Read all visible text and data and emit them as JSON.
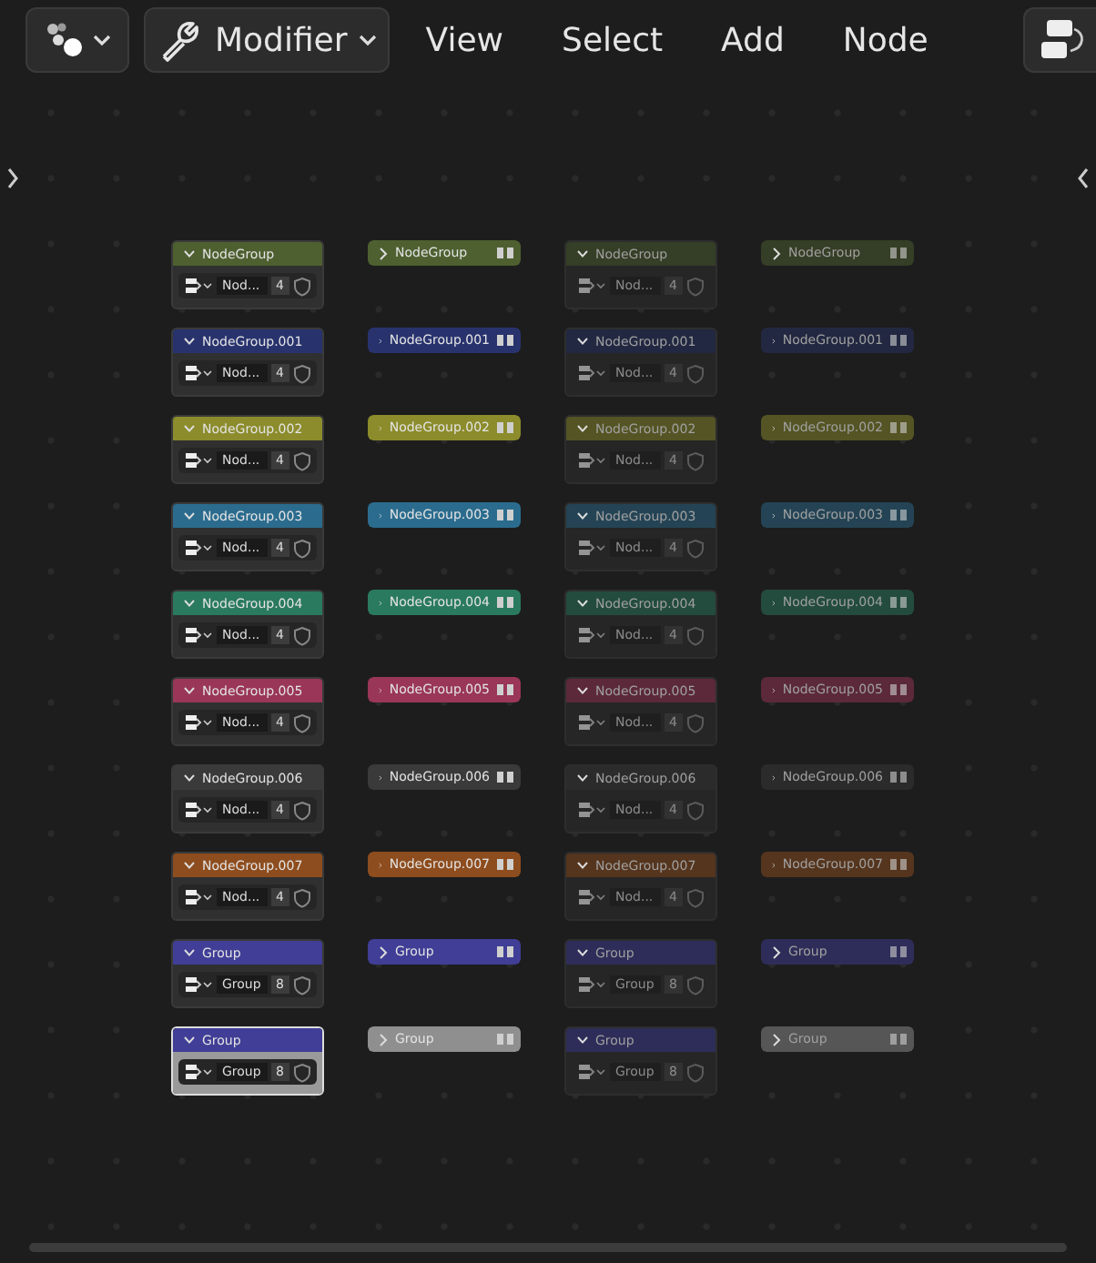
{
  "header": {
    "mode": "Modifier",
    "menus": [
      "View",
      "Select",
      "Add",
      "Node"
    ]
  },
  "nodes": [
    {
      "title": "NodeGroup",
      "color": "#4e6030",
      "collapsed": false,
      "muted": false,
      "active": false,
      "field": "Nod...",
      "count": "4"
    },
    {
      "title": "NodeGroup",
      "color": "#4e6030",
      "collapsed": true,
      "muted": false
    },
    {
      "title": "NodeGroup",
      "color": "#353e26",
      "collapsed": false,
      "muted": true,
      "active": false,
      "field": "Nod...",
      "count": "4"
    },
    {
      "title": "NodeGroup",
      "color": "#353e26",
      "collapsed": true,
      "muted": true
    },
    {
      "title": "NodeGroup.001",
      "color": "#28336e",
      "collapsed": false,
      "muted": false,
      "active": false,
      "field": "Nod...",
      "count": "4"
    },
    {
      "title": "NodeGroup.001",
      "color": "#28336e",
      "collapsed": true,
      "muted": false
    },
    {
      "title": "NodeGroup.001",
      "color": "#222841",
      "collapsed": false,
      "muted": true,
      "active": false,
      "field": "Nod...",
      "count": "4"
    },
    {
      "title": "NodeGroup.001",
      "color": "#222841",
      "collapsed": true,
      "muted": true
    },
    {
      "title": "NodeGroup.002",
      "color": "#8c8c2c",
      "collapsed": false,
      "muted": false,
      "active": false,
      "field": "Nod...",
      "count": "4"
    },
    {
      "title": "NodeGroup.002",
      "color": "#8c8c2c",
      "collapsed": true,
      "muted": false
    },
    {
      "title": "NodeGroup.002",
      "color": "#545424",
      "collapsed": false,
      "muted": true,
      "active": false,
      "field": "Nod...",
      "count": "4"
    },
    {
      "title": "NodeGroup.002",
      "color": "#545424",
      "collapsed": true,
      "muted": true
    },
    {
      "title": "NodeGroup.003",
      "color": "#2b6c8e",
      "collapsed": false,
      "muted": false,
      "active": false,
      "field": "Nod...",
      "count": "4"
    },
    {
      "title": "NodeGroup.003",
      "color": "#2b6c8e",
      "collapsed": true,
      "muted": false
    },
    {
      "title": "NodeGroup.003",
      "color": "#244455",
      "collapsed": false,
      "muted": true,
      "active": false,
      "field": "Nod...",
      "count": "4"
    },
    {
      "title": "NodeGroup.003",
      "color": "#244455",
      "collapsed": true,
      "muted": true
    },
    {
      "title": "NodeGroup.004",
      "color": "#2a7a60",
      "collapsed": false,
      "muted": false,
      "active": false,
      "field": "Nod...",
      "count": "4"
    },
    {
      "title": "NodeGroup.004",
      "color": "#2a7a60",
      "collapsed": true,
      "muted": false
    },
    {
      "title": "NodeGroup.004",
      "color": "#234b3e",
      "collapsed": false,
      "muted": true,
      "active": false,
      "field": "Nod...",
      "count": "4"
    },
    {
      "title": "NodeGroup.004",
      "color": "#234b3e",
      "collapsed": true,
      "muted": true
    },
    {
      "title": "NodeGroup.005",
      "color": "#9a3658",
      "collapsed": false,
      "muted": false,
      "active": false,
      "field": "Nod...",
      "count": "4"
    },
    {
      "title": "NodeGroup.005",
      "color": "#9a3658",
      "collapsed": true,
      "muted": false
    },
    {
      "title": "NodeGroup.005",
      "color": "#5b293a",
      "collapsed": false,
      "muted": true,
      "active": false,
      "field": "Nod...",
      "count": "4"
    },
    {
      "title": "NodeGroup.005",
      "color": "#5b293a",
      "collapsed": true,
      "muted": true
    },
    {
      "title": "NodeGroup.006",
      "color": "#3a3a3a",
      "collapsed": false,
      "muted": false,
      "active": false,
      "field": "Nod...",
      "count": "4"
    },
    {
      "title": "NodeGroup.006",
      "color": "#3a3a3a",
      "collapsed": true,
      "muted": false
    },
    {
      "title": "NodeGroup.006",
      "color": "#2b2b2b",
      "collapsed": false,
      "muted": true,
      "active": false,
      "field": "Nod...",
      "count": "4"
    },
    {
      "title": "NodeGroup.006",
      "color": "#2b2b2b",
      "collapsed": true,
      "muted": true
    },
    {
      "title": "NodeGroup.007",
      "color": "#8e4d1e",
      "collapsed": false,
      "muted": false,
      "active": false,
      "field": "Nod...",
      "count": "4"
    },
    {
      "title": "NodeGroup.007",
      "color": "#8e4d1e",
      "collapsed": true,
      "muted": false
    },
    {
      "title": "NodeGroup.007",
      "color": "#55351d",
      "collapsed": false,
      "muted": true,
      "active": false,
      "field": "Nod...",
      "count": "4"
    },
    {
      "title": "NodeGroup.007",
      "color": "#55351d",
      "collapsed": true,
      "muted": true
    },
    {
      "title": "Group",
      "color": "#403e96",
      "collapsed": false,
      "muted": false,
      "active": false,
      "field": "Group",
      "count": "8"
    },
    {
      "title": "Group",
      "color": "#403e96",
      "collapsed": true,
      "muted": false
    },
    {
      "title": "Group",
      "color": "#2e2d59",
      "collapsed": false,
      "muted": true,
      "active": false,
      "field": "Group",
      "count": "8"
    },
    {
      "title": "Group",
      "color": "#2e2d59",
      "collapsed": true,
      "muted": true
    },
    {
      "title": "Group",
      "color": "#403e96",
      "collapsed": false,
      "muted": false,
      "active": true,
      "field": "Group",
      "count": "8"
    },
    {
      "title": "Group",
      "color": "#8f8f8f",
      "collapsed": true,
      "muted": false
    },
    {
      "title": "Group",
      "color": "#2e2d59",
      "collapsed": false,
      "muted": true,
      "active": false,
      "field": "Group",
      "count": "8"
    },
    {
      "title": "Group",
      "color": "#565656",
      "collapsed": true,
      "muted": true
    }
  ]
}
